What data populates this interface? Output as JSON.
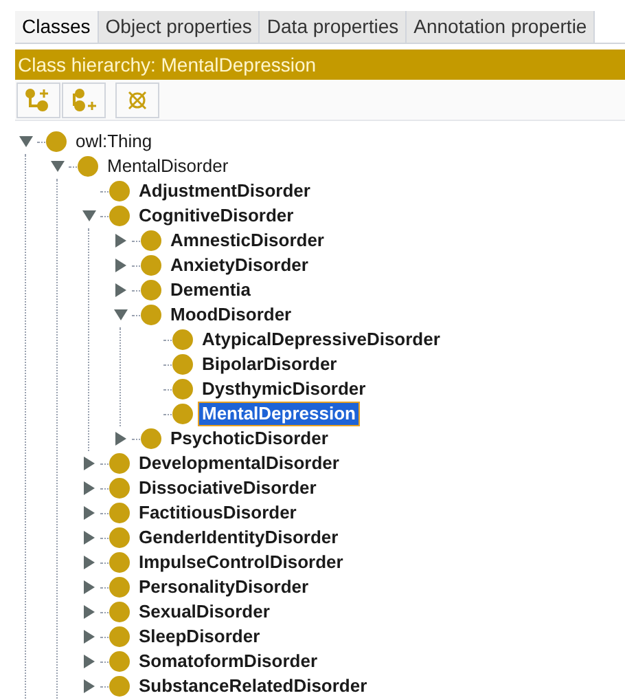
{
  "tabs": [
    {
      "label": "Classes",
      "selected": true
    },
    {
      "label": "Object properties",
      "selected": false
    },
    {
      "label": "Data properties",
      "selected": false
    },
    {
      "label": "Annotation propertie",
      "selected": false
    }
  ],
  "header": {
    "title": "Class hierarchy: MentalDepression"
  },
  "tree": [
    {
      "label": "owl:Thing",
      "kind": "branch",
      "expanded": true,
      "bold": false,
      "selected": false,
      "children": [
        {
          "label": "MentalDisorder",
          "kind": "branch",
          "expanded": true,
          "bold": false,
          "selected": false,
          "children": [
            {
              "label": "AdjustmentDisorder",
              "kind": "leaf",
              "bold": true,
              "selected": false
            },
            {
              "label": "CognitiveDisorder",
              "kind": "branch",
              "expanded": true,
              "bold": true,
              "selected": false,
              "children": [
                {
                  "label": "AmnesticDisorder",
                  "kind": "branch",
                  "expanded": false,
                  "bold": true,
                  "selected": false
                },
                {
                  "label": "AnxietyDisorder",
                  "kind": "branch",
                  "expanded": false,
                  "bold": true,
                  "selected": false
                },
                {
                  "label": "Dementia",
                  "kind": "branch",
                  "expanded": false,
                  "bold": true,
                  "selected": false
                },
                {
                  "label": "MoodDisorder",
                  "kind": "branch",
                  "expanded": true,
                  "bold": true,
                  "selected": false,
                  "children": [
                    {
                      "label": "AtypicalDepressiveDisorder",
                      "kind": "leaf",
                      "bold": true,
                      "selected": false
                    },
                    {
                      "label": "BipolarDisorder",
                      "kind": "leaf",
                      "bold": true,
                      "selected": false
                    },
                    {
                      "label": "DysthymicDisorder",
                      "kind": "leaf",
                      "bold": true,
                      "selected": false
                    },
                    {
                      "label": "MentalDepression",
                      "kind": "leaf",
                      "bold": true,
                      "selected": true
                    }
                  ]
                },
                {
                  "label": "PsychoticDisorder",
                  "kind": "branch",
                  "expanded": false,
                  "bold": true,
                  "selected": false
                }
              ]
            },
            {
              "label": "DevelopmentalDisorder",
              "kind": "branch",
              "expanded": false,
              "bold": true,
              "selected": false
            },
            {
              "label": "DissociativeDisorder",
              "kind": "branch",
              "expanded": false,
              "bold": true,
              "selected": false
            },
            {
              "label": "FactitiousDisorder",
              "kind": "branch",
              "expanded": false,
              "bold": true,
              "selected": false
            },
            {
              "label": "GenderIdentityDisorder",
              "kind": "branch",
              "expanded": false,
              "bold": true,
              "selected": false
            },
            {
              "label": "ImpulseControlDisorder",
              "kind": "branch",
              "expanded": false,
              "bold": true,
              "selected": false
            },
            {
              "label": "PersonalityDisorder",
              "kind": "branch",
              "expanded": false,
              "bold": true,
              "selected": false
            },
            {
              "label": "SexualDisorder",
              "kind": "branch",
              "expanded": false,
              "bold": true,
              "selected": false
            },
            {
              "label": "SleepDisorder",
              "kind": "branch",
              "expanded": false,
              "bold": true,
              "selected": false
            },
            {
              "label": "SomatoformDisorder",
              "kind": "branch",
              "expanded": false,
              "bold": true,
              "selected": false
            },
            {
              "label": "SubstanceRelatedDisorder",
              "kind": "branch",
              "expanded": false,
              "bold": true,
              "selected": false
            }
          ]
        }
      ]
    }
  ]
}
